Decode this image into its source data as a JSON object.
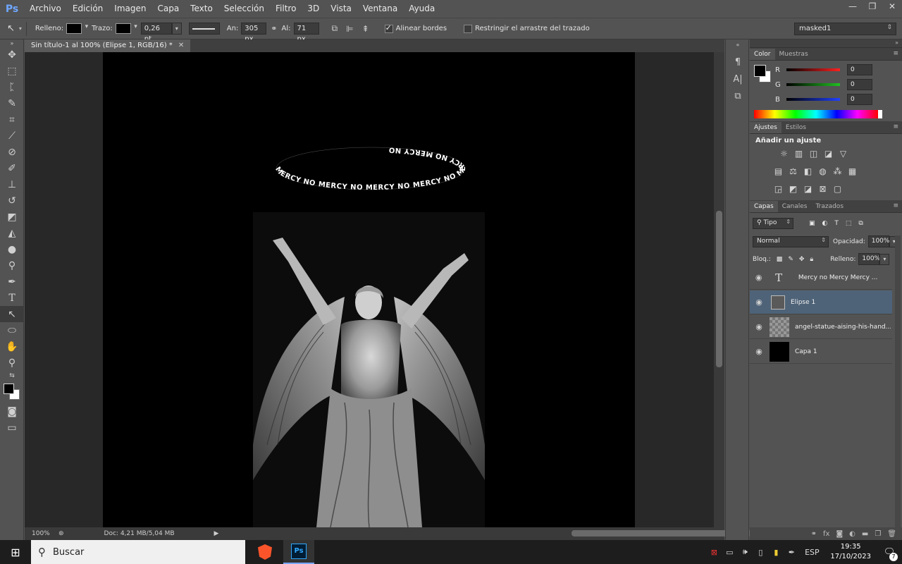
{
  "app": {
    "logo": "Ps"
  },
  "menu": [
    "Archivo",
    "Edición",
    "Imagen",
    "Capa",
    "Texto",
    "Selección",
    "Filtro",
    "3D",
    "Vista",
    "Ventana",
    "Ayuda"
  ],
  "window_controls": {
    "minimize": "—",
    "restore": "❐",
    "close": "✕"
  },
  "options_bar": {
    "fill_label": "Relleno:",
    "stroke_label": "Trazo:",
    "stroke_width": "0,26 pt",
    "width_label": "An:",
    "width_value": "305 px",
    "height_label": "Al:",
    "height_value": "71 px",
    "align_edges_label": "Alinear bordes",
    "align_edges_checked": true,
    "constrain_label": "Restringir el arrastre del trazado",
    "constrain_checked": false,
    "preset": "masked1"
  },
  "document": {
    "tab_title": "Sin título-1 al 100% (Elipse 1, RGB/16) *",
    "halo_text": "MERCY NO MERCY NO MERCY NO MERCY NO MERCY NO MERCY NO ",
    "zoom": "100%",
    "doc_info": "Doc: 4,21 MB/5,04 MB"
  },
  "color_panel": {
    "tabs": [
      "Color",
      "Muestras"
    ],
    "channels": [
      {
        "label": "R",
        "value": "0",
        "color": "#ff2020"
      },
      {
        "label": "G",
        "value": "0",
        "color": "#20c020"
      },
      {
        "label": "B",
        "value": "0",
        "color": "#2040ff"
      }
    ]
  },
  "adjustments_panel": {
    "tabs": [
      "Ajustes",
      "Estilos"
    ],
    "title": "Añadir un ajuste"
  },
  "layers_panel": {
    "tabs": [
      "Capas",
      "Canales",
      "Trazados"
    ],
    "filter_kind": "Tipo",
    "blend_mode": "Normal",
    "opacity_label": "Opacidad:",
    "opacity_value": "100%",
    "lock_label": "Bloq.:",
    "fill_label": "Relleno:",
    "fill_value": "100%",
    "layers": [
      {
        "name": "Mercy    no Mercy  Mercy ...",
        "kind": "text",
        "selected": false
      },
      {
        "name": "Elipse 1",
        "kind": "shape",
        "selected": true
      },
      {
        "name": "angel-statue-aising-his-hand...",
        "kind": "image",
        "selected": false
      },
      {
        "name": "Capa 1",
        "kind": "fill",
        "selected": false
      }
    ]
  },
  "taskbar": {
    "search_placeholder": "Buscar",
    "language": "ESP",
    "time": "19:35",
    "date": "17/10/2023",
    "notification_count": "7"
  }
}
